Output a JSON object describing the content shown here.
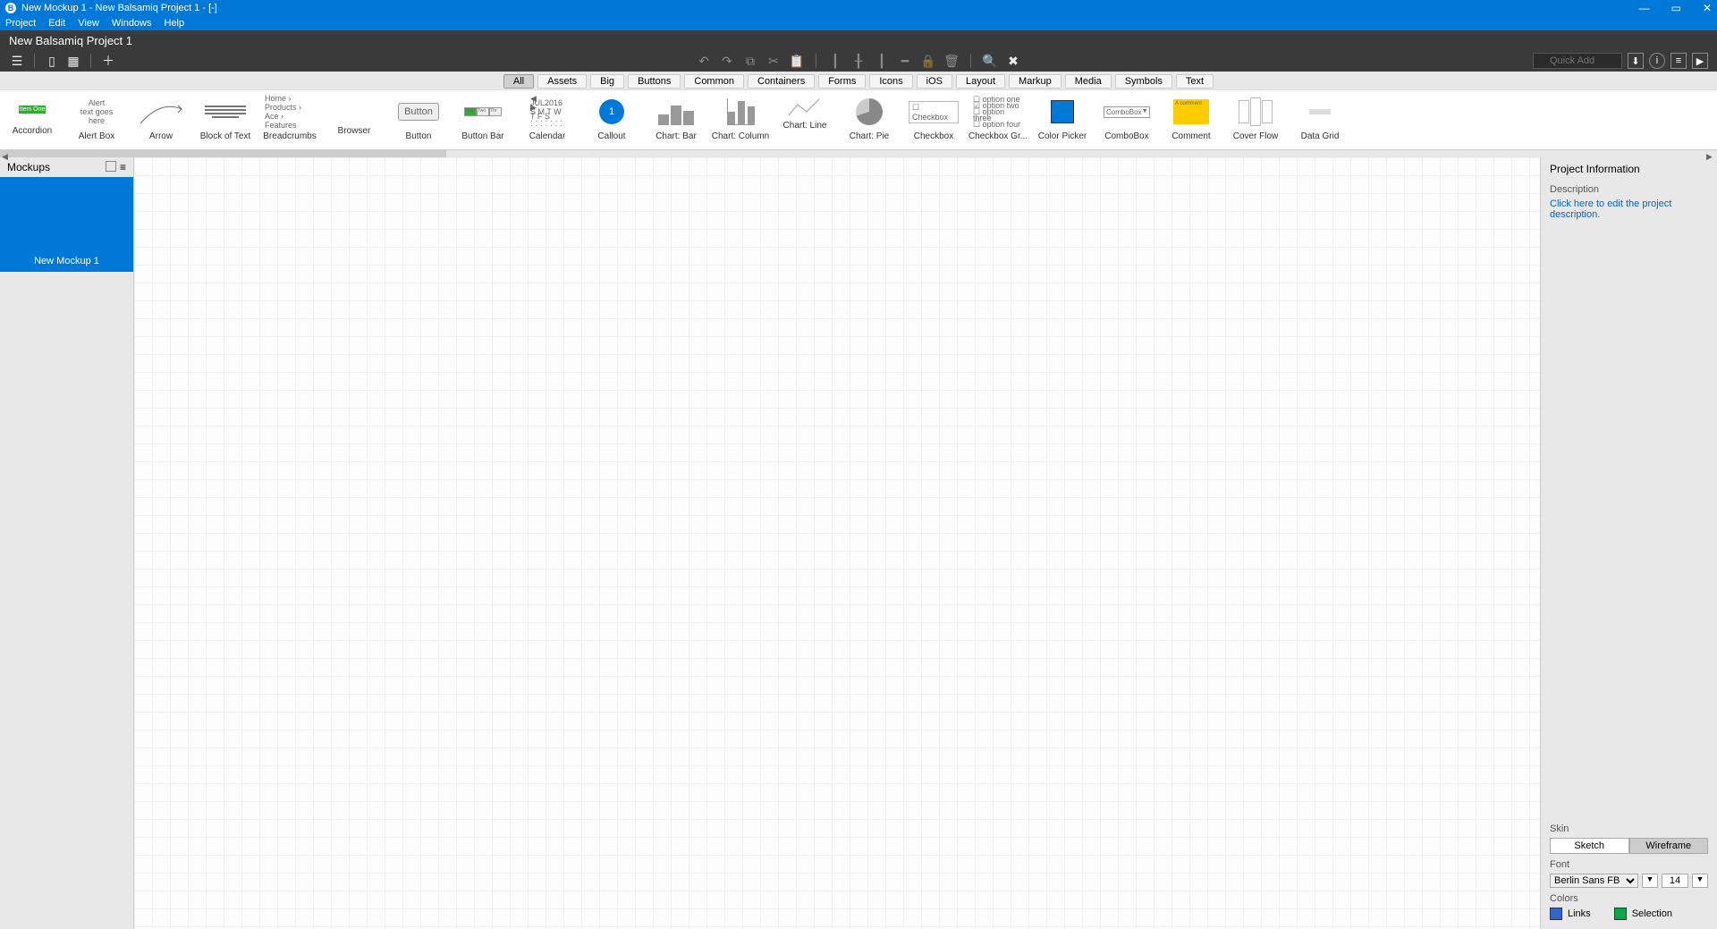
{
  "titleBar": {
    "title": "New Mockup 1 - New Balsamiq Project 1 - [-]",
    "appIcon": "B"
  },
  "menuBar": {
    "items": [
      "Project",
      "Edit",
      "View",
      "Windows",
      "Help"
    ]
  },
  "projectTitle": "New Balsamiq Project 1",
  "quickAdd": {
    "placeholder": "Quick Add"
  },
  "categoryTabs": {
    "items": [
      "All",
      "Assets",
      "Big",
      "Buttons",
      "Common",
      "Containers",
      "Forms",
      "Icons",
      "iOS",
      "Layout",
      "Markup",
      "Media",
      "Symbols",
      "Text"
    ],
    "active": "All"
  },
  "galleryItems": [
    "Accordion",
    "Alert Box",
    "Arrow",
    "Block of Text",
    "Breadcrumbs",
    "Browser",
    "Button",
    "Button Bar",
    "Calendar",
    "Callout",
    "Chart: Bar",
    "Chart: Column",
    "Chart: Line",
    "Chart: Pie",
    "Checkbox",
    "Checkbox Gr...",
    "Color Picker",
    "ComboBox",
    "Comment",
    "Cover Flow",
    "Data Grid"
  ],
  "mockups": {
    "panelTitle": "Mockups",
    "items": [
      "New Mockup 1"
    ]
  },
  "rightPanel": {
    "infoTitle": "Project Information",
    "descLabel": "Description",
    "descPlaceholder": "Click here to edit the project description.",
    "skinLabel": "Skin",
    "skinOptions": [
      "Sketch",
      "Wireframe"
    ],
    "skinActive": "Wireframe",
    "fontLabel": "Font",
    "fontName": "Berlin Sans FB",
    "fontSize": "14",
    "colorsLabel": "Colors",
    "linkLabel": "Links",
    "linkColor": "#3366cc",
    "selectionLabel": "Selection",
    "selectionColor": "#00aa44"
  },
  "thumbs": {
    "button": "Button",
    "checkbox": "Checkbox",
    "combo": "ComboBox",
    "comment": "A comment",
    "callout": "1"
  }
}
